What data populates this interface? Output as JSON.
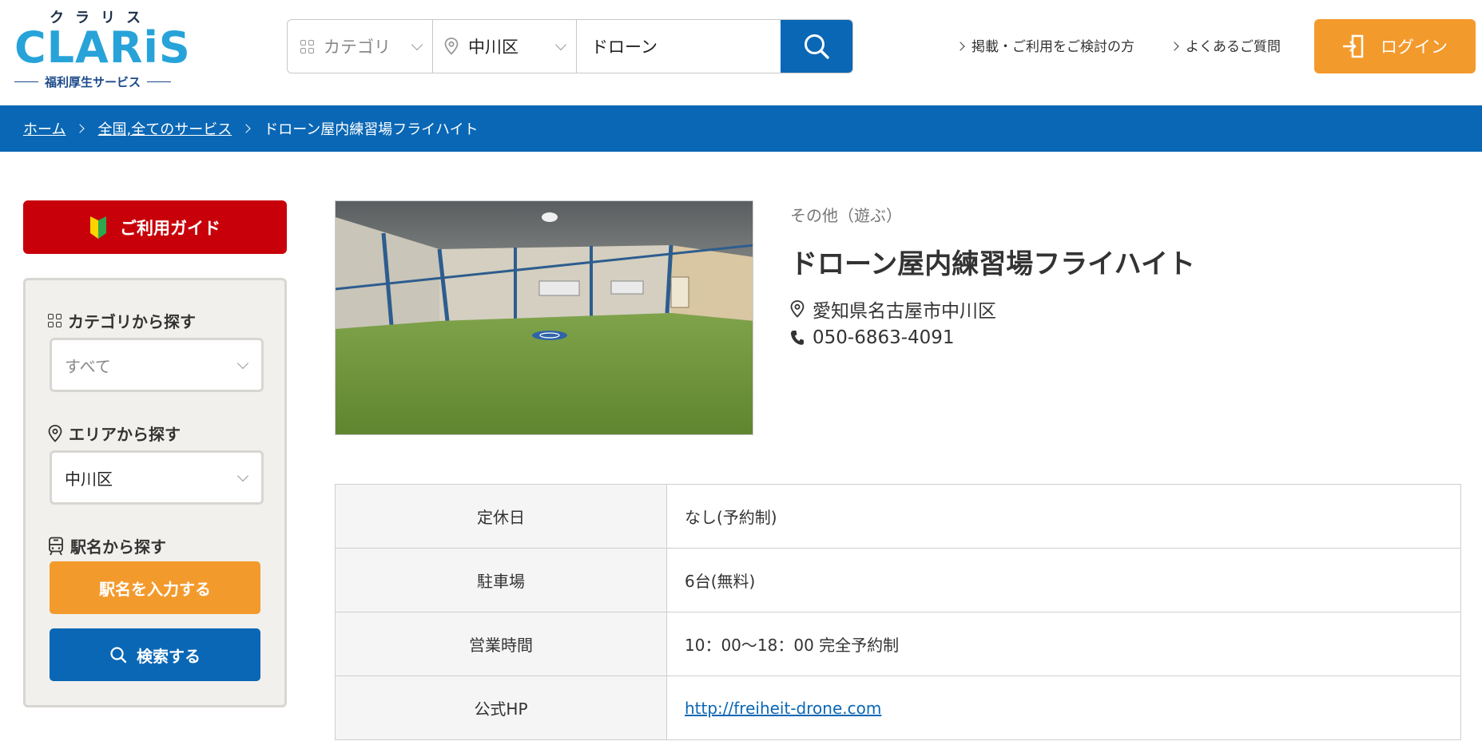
{
  "logo": {
    "kana": "クラリス",
    "main": "CLARiS",
    "sub": "福利厚生サービス"
  },
  "search": {
    "category_placeholder": "カテゴリ",
    "area_value": "中川区",
    "keyword_value": "ドローン"
  },
  "toplinks": [
    {
      "label": "掲載・ご利用をご検討の方"
    },
    {
      "label": "よくあるご質問"
    }
  ],
  "login_label": "ログイン",
  "breadcrumb": [
    {
      "label": "ホーム"
    },
    {
      "label": "全国,全てのサービス"
    },
    {
      "label": "ドローン屋内練習場フライハイト"
    }
  ],
  "sidebar": {
    "guide_label": "ご利用ガイド",
    "category_heading": "カテゴリから探す",
    "category_value": "すべて",
    "area_heading": "エリアから探す",
    "area_value": "中川区",
    "station_heading": "駅名から探す",
    "station_button": "駅名を入力する",
    "search_button": "検索する"
  },
  "facility": {
    "category": "その他（遊ぶ）",
    "name": "ドローン屋内練習場フライハイト",
    "address": "愛知県名古屋市中川区",
    "phone": "050-6863-4091"
  },
  "details": [
    {
      "label": "定休日",
      "value": "なし(予約制)"
    },
    {
      "label": "駐車場",
      "value": "6台(無料)"
    },
    {
      "label": "営業時間",
      "value": "10：00〜18：00 完全予約制"
    },
    {
      "label": "公式HP",
      "value": "http://freiheit-drone.com"
    }
  ],
  "colors": {
    "brand_blue": "#0a67b5",
    "accent_orange": "#f39a2c",
    "guide_red": "#c8000a",
    "logo_cyan": "#27a3d9"
  }
}
